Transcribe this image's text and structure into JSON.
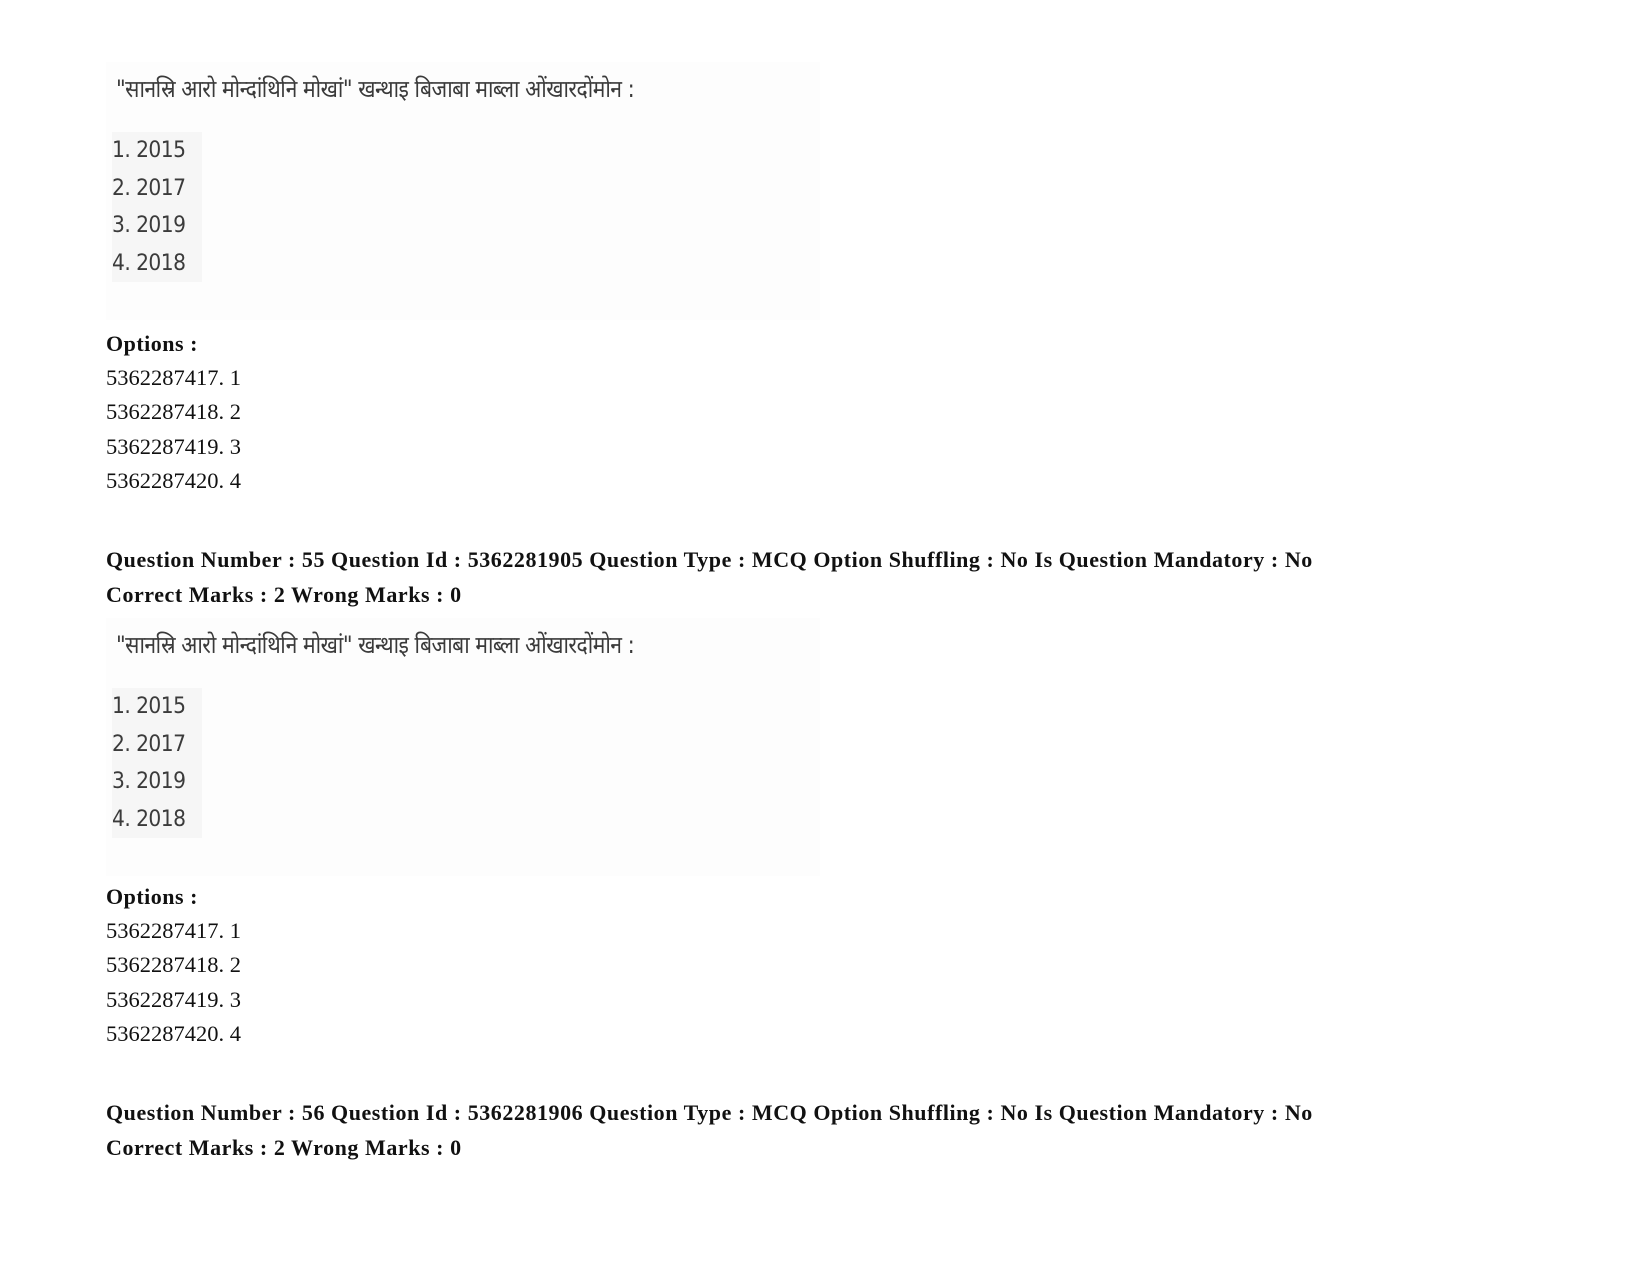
{
  "blocks": [
    {
      "question_image": {
        "prompt": "\"सानस्रि आरो मोन्दांथिनि मोखां\" खन्थाइ बिजाबा माब्ला ओंखारदोंमोन :",
        "choices": [
          "1. 2015",
          "2. 2017",
          "3. 2019",
          "4. 2018"
        ]
      },
      "options_label": "Options :",
      "options": [
        "5362287417. 1",
        "5362287418. 2",
        "5362287419. 3",
        "5362287420. 4"
      ]
    },
    {
      "header": {
        "line1": "Question Number : 55 Question Id : 5362281905 Question Type : MCQ Option Shuffling : No Is Question Mandatory : No",
        "line2": "Correct Marks : 2 Wrong Marks : 0"
      },
      "question_image": {
        "prompt": "\"सानस्रि आरो मोन्दांथिनि मोखां\" खन्थाइ बिजाबा माब्ला ओंखारदोंमोन :",
        "choices": [
          "1. 2015",
          "2. 2017",
          "3. 2019",
          "4. 2018"
        ]
      },
      "options_label": "Options :",
      "options": [
        "5362287417. 1",
        "5362287418. 2",
        "5362287419. 3",
        "5362287420. 4"
      ]
    },
    {
      "header": {
        "line1": "Question Number : 56 Question Id : 5362281906 Question Type : MCQ Option Shuffling : No Is Question Mandatory : No",
        "line2": "Correct Marks : 2 Wrong Marks : 0"
      }
    }
  ]
}
